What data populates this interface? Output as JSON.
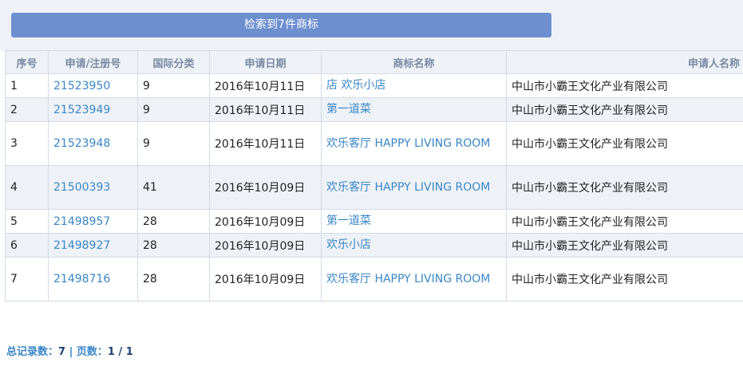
{
  "search": {
    "result_label": "检索到7件商标"
  },
  "table": {
    "columns": [
      "序号",
      "申请/注册号",
      "国际分类",
      "申请日期",
      "商标名称",
      "申请人名称"
    ],
    "rows": [
      {
        "index": "1",
        "reg_no": "21523950",
        "class": "9",
        "date": "2016年10月11日",
        "mark": "店 欢乐小店",
        "applicant": "中山市小霸王文化产业有限公司"
      },
      {
        "index": "2",
        "reg_no": "21523949",
        "class": "9",
        "date": "2016年10月11日",
        "mark": "第一道菜",
        "applicant": "中山市小霸王文化产业有限公司"
      },
      {
        "index": "3",
        "reg_no": "21523948",
        "class": "9",
        "date": "2016年10月11日",
        "mark": "欢乐客厅 HAPPY LIVING ROOM",
        "applicant": "中山市小霸王文化产业有限公司"
      },
      {
        "index": "4",
        "reg_no": "21500393",
        "class": "41",
        "date": "2016年10月09日",
        "mark": "欢乐客厅 HAPPY LIVING ROOM",
        "applicant": "中山市小霸王文化产业有限公司"
      },
      {
        "index": "5",
        "reg_no": "21498957",
        "class": "28",
        "date": "2016年10月09日",
        "mark": "第一道菜",
        "applicant": "中山市小霸王文化产业有限公司"
      },
      {
        "index": "6",
        "reg_no": "21498927",
        "class": "28",
        "date": "2016年10月09日",
        "mark": "欢乐小店",
        "applicant": "中山市小霸王文化产业有限公司"
      },
      {
        "index": "7",
        "reg_no": "21498716",
        "class": "28",
        "date": "2016年10月09日",
        "mark": "欢乐客厅 HAPPY LIVING ROOM",
        "applicant": "中山市小霸王文化产业有限公司"
      }
    ]
  },
  "footer": {
    "total_label": "总记录数：",
    "total_value": "7",
    "separator": " | ",
    "pages_label": "页数：",
    "pages_value": "1 / 1"
  },
  "colors": {
    "result_bar": "#6d8fcf",
    "link": "#3a86c8",
    "header_bg": "#eef2f7",
    "alt_row_bg": "#eef2f7"
  }
}
